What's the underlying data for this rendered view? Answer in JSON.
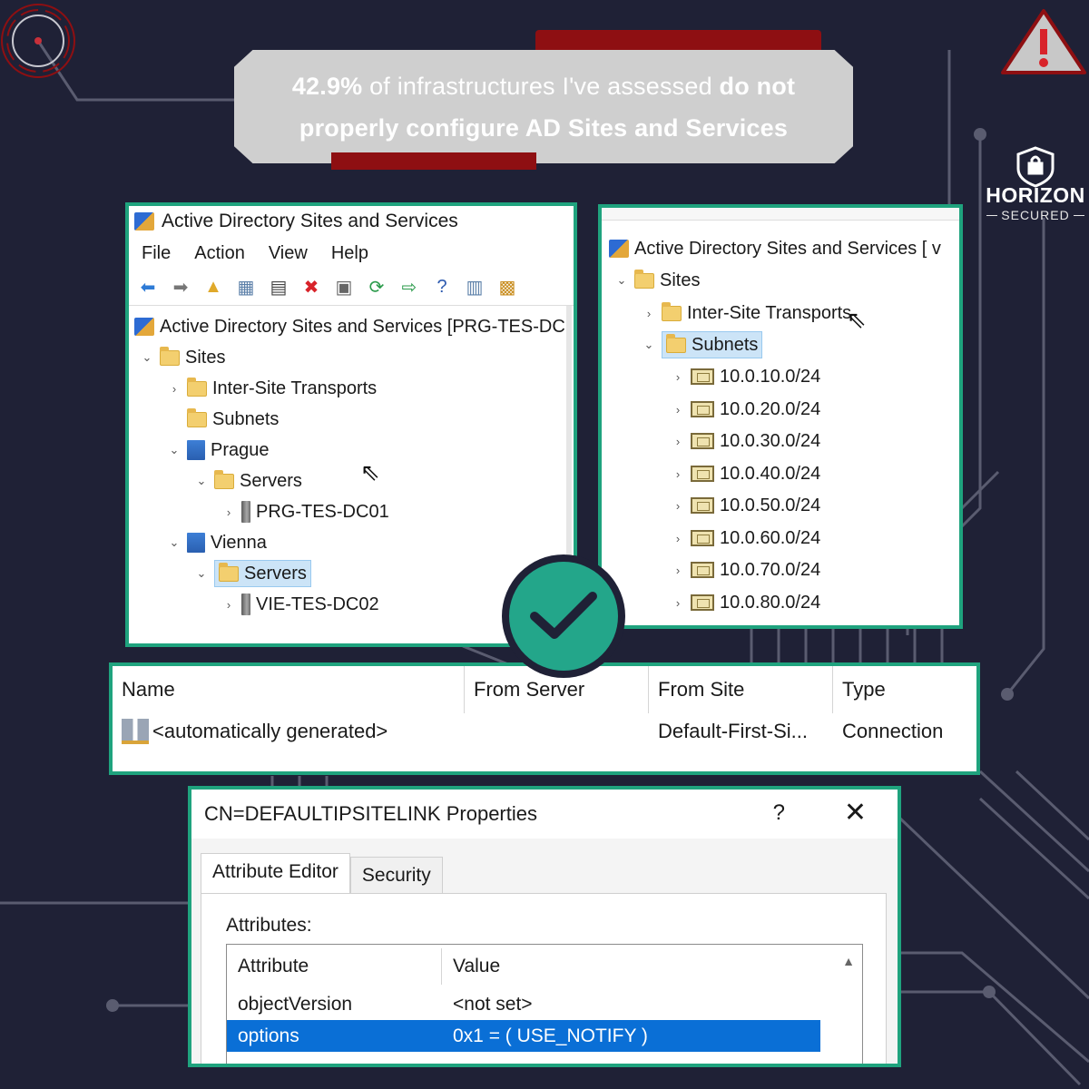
{
  "headline": {
    "stat": "42.9%",
    "middle": " of infrastructures I've assessed ",
    "bold1": "do not",
    "bold2": "properly configure AD Sites and Services"
  },
  "brand": {
    "name": "HORIZON",
    "sub": "SECURED"
  },
  "colors": {
    "accent": "#1fa37e",
    "banner_red": "#8e0f12",
    "background": "#1f2136",
    "check": "#23a68a"
  },
  "win1": {
    "title": "Active Directory Sites and Services",
    "menu": [
      "File",
      "Action",
      "View",
      "Help"
    ],
    "tree": {
      "root": "Active Directory Sites and Services [PRG-TES-DC",
      "sites": "Sites",
      "inter_site": "Inter-Site Transports",
      "subnets": "Subnets",
      "prague": "Prague",
      "prague_servers": "Servers",
      "prague_dc": "PRG-TES-DC01",
      "vienna": "Vienna",
      "vienna_servers": "Servers",
      "vienna_dc": "VIE-TES-DC02"
    }
  },
  "win2": {
    "root": "Active Directory Sites and Services [ v",
    "sites": "Sites",
    "inter_site": "Inter-Site Transports",
    "subnets": "Subnets",
    "subnet_list": [
      "10.0.10.0/24",
      "10.0.20.0/24",
      "10.0.30.0/24",
      "10.0.40.0/24",
      "10.0.50.0/24",
      "10.0.60.0/24",
      "10.0.70.0/24",
      "10.0.80.0/24"
    ]
  },
  "conn": {
    "headers": [
      "Name",
      "From Server",
      "From Site",
      "Type"
    ],
    "row": {
      "name": "<automatically generated>",
      "from_server": "",
      "from_site": "Default-First-Si...",
      "type": "Connection"
    }
  },
  "dialog": {
    "title": "CN=DEFAULTIPSITELINK Properties",
    "help": "?",
    "close": "✕",
    "tabs": [
      "Attribute Editor",
      "Security"
    ],
    "attributes_label": "Attributes:",
    "headers": [
      "Attribute",
      "Value"
    ],
    "rows": [
      {
        "attr": "objectVersion",
        "value": "<not set>"
      },
      {
        "attr": "options",
        "value": "0x1 = ( USE_NOTIFY )"
      }
    ]
  },
  "icons": [
    "target-icon",
    "warning-icon",
    "shield-lock-icon",
    "check-icon",
    "cursor-icon",
    "folder-icon",
    "site-icon",
    "server-icon",
    "subnet-icon"
  ]
}
